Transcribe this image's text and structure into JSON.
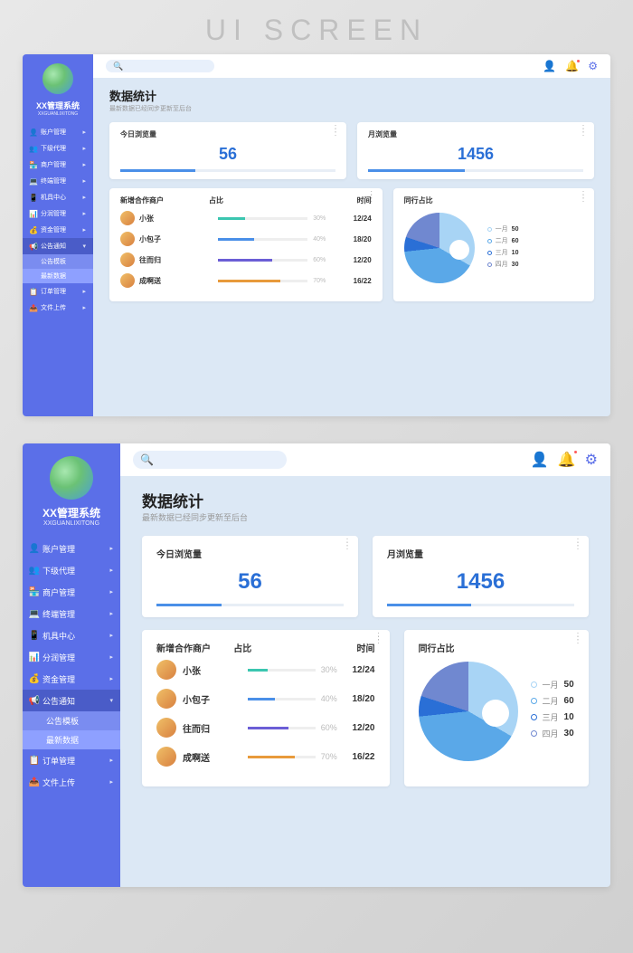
{
  "page_header": "UI SCREEN",
  "brand": {
    "title": "XX管理系统",
    "subtitle": "XXGUANLIXITONG"
  },
  "sidebar": {
    "items": [
      {
        "icon": "user-icon",
        "label": "账户管理"
      },
      {
        "icon": "users-icon",
        "label": "下级代理"
      },
      {
        "icon": "shop-icon",
        "label": "商户管理"
      },
      {
        "icon": "terminal-icon",
        "label": "终端管理"
      },
      {
        "icon": "device-icon",
        "label": "机具中心"
      },
      {
        "icon": "share-icon",
        "label": "分润管理"
      },
      {
        "icon": "money-icon",
        "label": "资金管理"
      },
      {
        "icon": "megaphone-icon",
        "label": "公告通知",
        "active": true,
        "expanded": true,
        "children": [
          {
            "label": "公告模板"
          },
          {
            "label": "最新数据",
            "selected": true
          }
        ]
      },
      {
        "icon": "order-icon",
        "label": "订单管理"
      },
      {
        "icon": "upload-icon",
        "label": "文件上传"
      }
    ]
  },
  "topbar": {
    "icons": [
      "user-icon",
      "bell-icon",
      "gear-icon"
    ]
  },
  "page": {
    "title": "数据统计",
    "subtitle": "最新数据已经同步更新至后台"
  },
  "stats": [
    {
      "label": "今日浏览量",
      "value": "56",
      "progress": 35
    },
    {
      "label": "月浏览量",
      "value": "1456",
      "progress": 45
    }
  ],
  "table": {
    "headers": [
      "新增合作商户",
      "占比",
      "时间"
    ],
    "rows": [
      {
        "name": "小张",
        "percent": "30%",
        "pval": 30,
        "color": "#3bc6b0",
        "time": "12/24"
      },
      {
        "name": "小包子",
        "percent": "40%",
        "pval": 40,
        "color": "#4a8fe8",
        "time": "18/20"
      },
      {
        "name": "往而归",
        "percent": "60%",
        "pval": 60,
        "color": "#6b5ed6",
        "time": "12/20"
      },
      {
        "name": "成啊送",
        "percent": "70%",
        "pval": 70,
        "color": "#e89a3b",
        "time": "16/22"
      }
    ]
  },
  "pie": {
    "title": "同行占比",
    "legend": [
      {
        "label": "一月",
        "value": "50",
        "color": "#a8d4f5"
      },
      {
        "label": "二月",
        "value": "60",
        "color": "#5aa8e8"
      },
      {
        "label": "三月",
        "value": "10",
        "color": "#2a6fd6"
      },
      {
        "label": "四月",
        "value": "30",
        "color": "#7088d0"
      }
    ]
  },
  "chart_data": {
    "type": "pie",
    "title": "同行占比",
    "categories": [
      "一月",
      "二月",
      "三月",
      "四月"
    ],
    "values": [
      50,
      60,
      10,
      30
    ],
    "colors": [
      "#a8d4f5",
      "#5aa8e8",
      "#2a6fd6",
      "#7088d0"
    ]
  }
}
